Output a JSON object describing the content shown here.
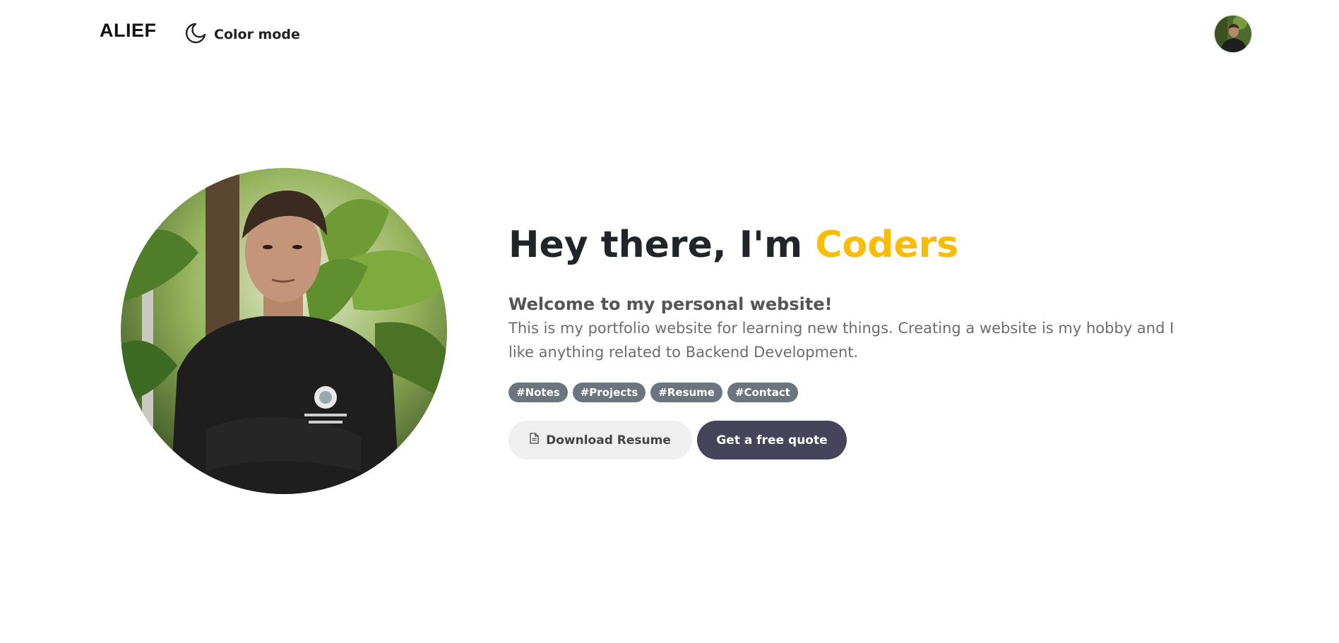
{
  "nav": {
    "brand": "ALIEF",
    "color_mode_label": "Color mode",
    "color_mode_icon": "moon-icon"
  },
  "hero": {
    "headline_prefix": "Hey there, I'm ",
    "headline_accent": "Coders",
    "welcome": "Welcome to my personal website!",
    "description": "This is my portfolio website for learning new things. Creating a website is my hobby and I like anything related to Backend Development.",
    "tags": [
      "#Notes",
      "#Projects",
      "#Resume",
      "#Contact"
    ],
    "download_label": "Download Resume",
    "download_icon": "document-icon",
    "quote_label": "Get a free quote"
  },
  "colors": {
    "accent": "#fbbc05",
    "tag_bg": "#6c757d",
    "primary_button": "#46445a",
    "secondary_button": "#efefef"
  }
}
